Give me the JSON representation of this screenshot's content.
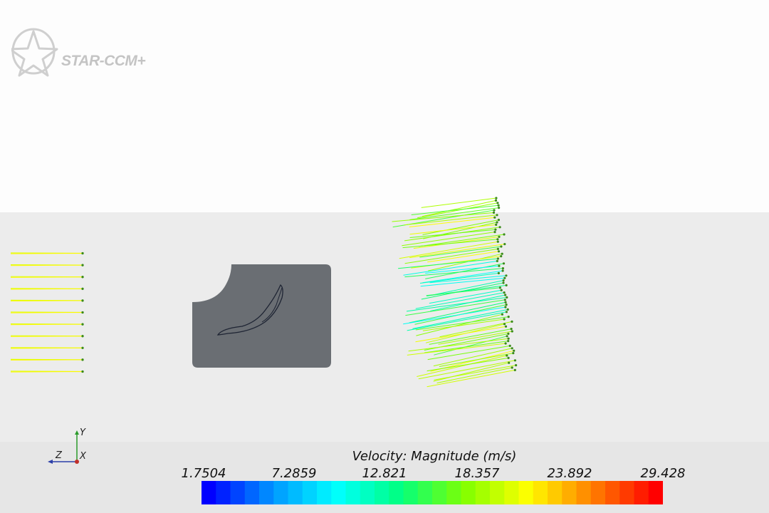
{
  "app": {
    "logo_text": "STAR-CCM+"
  },
  "axes": {
    "y_label": "Y",
    "z_label": "Z",
    "x_label": "X",
    "y_color": "#2a9a2a",
    "z_color": "#2c3fa8",
    "x_color": "#c0302a"
  },
  "legend": {
    "title": "Velocity: Magnitude (m/s)",
    "ticks": [
      "1.7504",
      "7.2859",
      "12.821",
      "18.357",
      "23.892",
      "29.428"
    ],
    "range": [
      1.7504,
      29.428
    ],
    "colormap": [
      "#0000ff",
      "#0096ff",
      "#00ffff",
      "#00ff80",
      "#80ff00",
      "#ffff00",
      "#ff8000",
      "#ff0000"
    ],
    "segments": 32
  },
  "scene": {
    "background_top": "#fdfdfd",
    "background_bottom": "#ececec",
    "blade_block_color": "#6a6e73",
    "blade_outline_color": "#1e2433"
  }
}
